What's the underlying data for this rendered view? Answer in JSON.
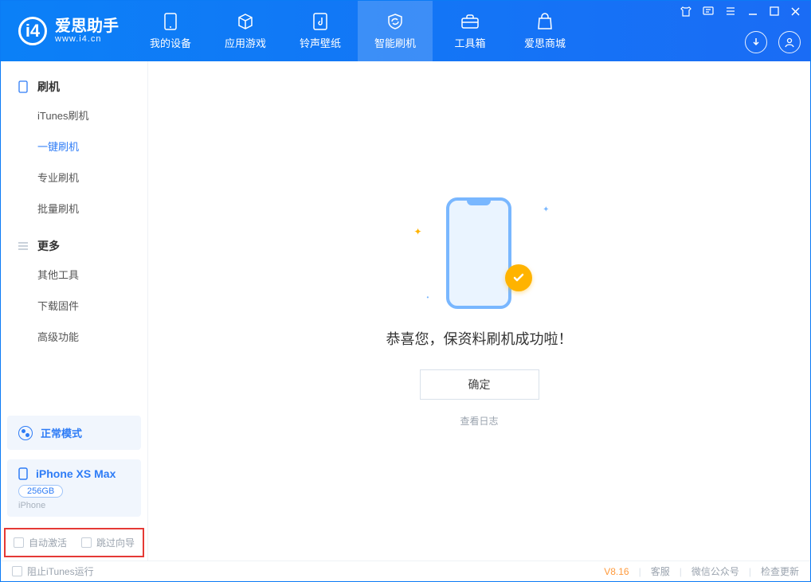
{
  "app": {
    "name_cn": "爱思助手",
    "url": "www.i4.cn"
  },
  "nav": {
    "items": [
      {
        "label": "我的设备"
      },
      {
        "label": "应用游戏"
      },
      {
        "label": "铃声壁纸"
      },
      {
        "label": "智能刷机"
      },
      {
        "label": "工具箱"
      },
      {
        "label": "爱思商城"
      }
    ]
  },
  "sidebar": {
    "section1_title": "刷机",
    "section1_items": [
      {
        "label": "iTunes刷机"
      },
      {
        "label": "一键刷机"
      },
      {
        "label": "专业刷机"
      },
      {
        "label": "批量刷机"
      }
    ],
    "section2_title": "更多",
    "section2_items": [
      {
        "label": "其他工具"
      },
      {
        "label": "下载固件"
      },
      {
        "label": "高级功能"
      }
    ],
    "mode_label": "正常模式",
    "device": {
      "name": "iPhone XS Max",
      "storage": "256GB",
      "type": "iPhone"
    },
    "opt_auto_activate": "自动激活",
    "opt_skip_guide": "跳过向导"
  },
  "main": {
    "success_message": "恭喜您，保资料刷机成功啦！",
    "ok_button": "确定",
    "view_log": "查看日志"
  },
  "statusbar": {
    "block_itunes": "阻止iTunes运行",
    "version": "V8.16",
    "links": [
      {
        "label": "客服"
      },
      {
        "label": "微信公众号"
      },
      {
        "label": "检查更新"
      }
    ]
  }
}
